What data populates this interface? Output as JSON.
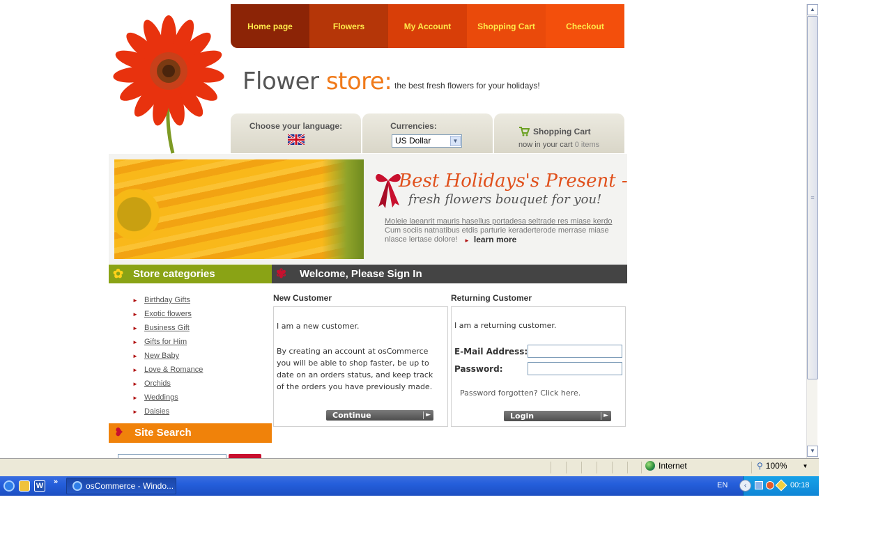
{
  "colors": {
    "nav_gradient": [
      "#8c2406",
      "#b53608",
      "#d83e08",
      "#ea4a0b",
      "#f34f0c"
    ],
    "nav_text": "#ffe94a",
    "category_green": "#8aa315",
    "search_orange": "#f0820a",
    "welcome_dark": "#444444",
    "logo_orange": "#f07a1a"
  },
  "nav": {
    "items": [
      "Home page",
      "Flowers",
      "My Account",
      "Shopping Cart",
      "Checkout"
    ]
  },
  "logo": {
    "word1": "Flower",
    "word2": "store:",
    "tagline": "the best fresh flowers for your holidays!"
  },
  "tabs": {
    "language_label": "Choose your language:",
    "language_icon": "uk-flag-icon",
    "currency_label": "Currencies:",
    "currency_selected": "US Dollar",
    "cart_title": "Shopping Cart",
    "cart_prefix": "now in your cart",
    "cart_count": "0 items"
  },
  "banner": {
    "title": "Best Holidays's Present -",
    "subtitle": "fresh flowers bouquet for you!",
    "link_text": "Moleie laeanrit mauris hasellus portadesa seltrade res miase kerdo",
    "text_line1": "Cum sociis natnatibus etdis parturie keraderterode merrase miase",
    "text_line2": "nlasce lertase dolore!",
    "learn_more": "learn more"
  },
  "categories": {
    "title": "Store categories",
    "items": [
      "Birthday Gifts",
      "Exotic flowers",
      "Business Gift",
      "Gifts for Him",
      "New Baby",
      "Love & Romance",
      "Orchids",
      "Weddings",
      "Daisies"
    ]
  },
  "search": {
    "title": "Site Search"
  },
  "welcome": {
    "title": "Welcome, Please Sign In",
    "new_customer": {
      "title": "New Customer",
      "line1": "I am a new customer.",
      "desc": [
        "By creating an account at osCommerce",
        "you will be able to shop faster, be up to",
        "date on an orders status, and keep track",
        "of the orders you have previously made."
      ],
      "button": "Continue"
    },
    "returning_customer": {
      "title": "Returning Customer",
      "line1": "I am a returning customer.",
      "email_label": "E-Mail Address:",
      "password_label": "Password:",
      "forgot": "Password forgotten? Click here.",
      "button": "Login"
    }
  },
  "statusbar": {
    "zone": "Internet",
    "zoom": "100%"
  },
  "taskbar": {
    "window_title": "osCommerce - Windo...",
    "language": "EN",
    "time": "00:18"
  }
}
